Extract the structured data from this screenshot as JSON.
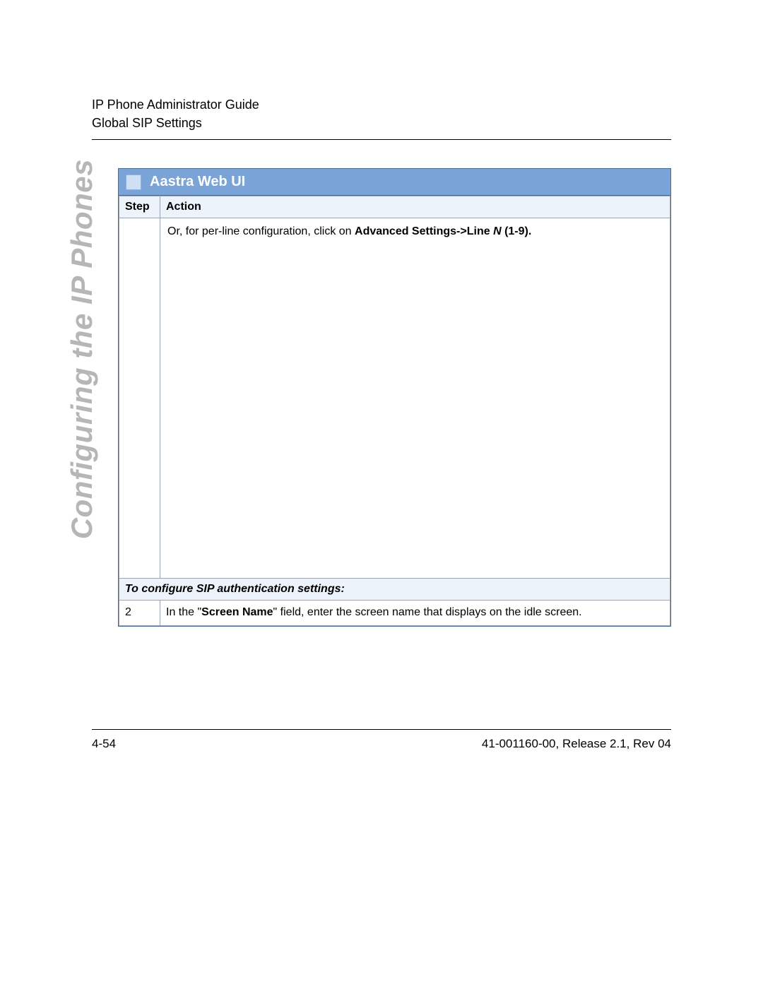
{
  "header": {
    "line1": "IP Phone Administrator Guide",
    "line2": "Global SIP Settings"
  },
  "side_label": "Configuring the IP Phones",
  "panel": {
    "title": "Aastra Web UI",
    "columns": {
      "step": "Step",
      "action": "Action"
    },
    "row1": {
      "prefix": "Or, for per-line configuration, click on ",
      "bold1": "Advanced Settings->Line ",
      "bold_italic": "N",
      "bold2": " (1-9)."
    },
    "section_heading": "To configure SIP authentication settings:",
    "row2": {
      "step": "2",
      "prefix": "In the \"",
      "bold": "Screen Name",
      "suffix": "\" field, enter the screen name that displays on the idle screen."
    }
  },
  "footer": {
    "left": "4-54",
    "right": "41-001160-00, Release 2.1, Rev 04"
  }
}
